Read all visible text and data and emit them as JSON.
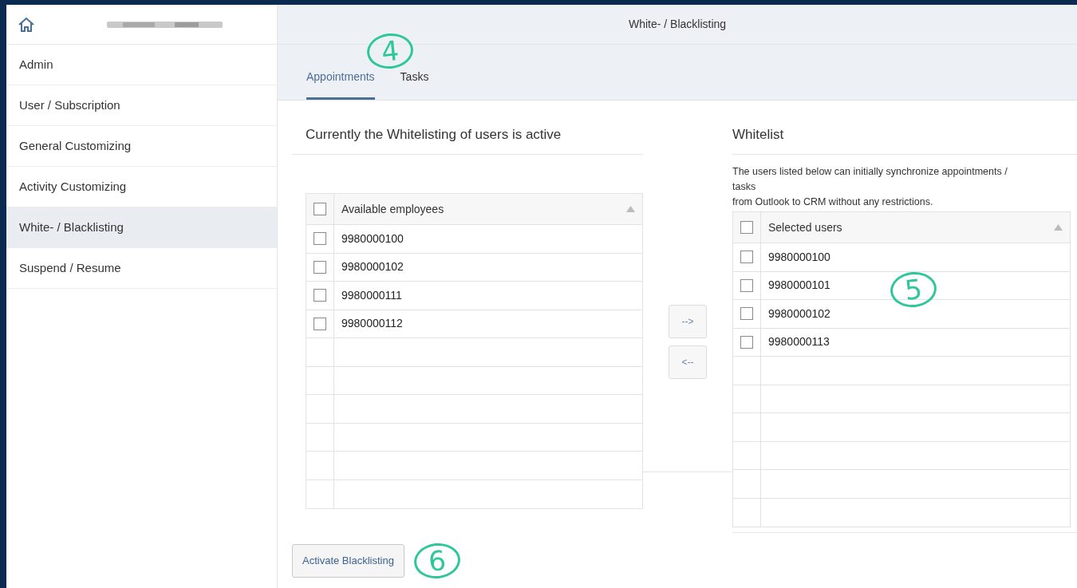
{
  "sidebar": {
    "items": [
      {
        "label": "Admin",
        "selected": false
      },
      {
        "label": "User / Subscription",
        "selected": false
      },
      {
        "label": "General Customizing",
        "selected": false
      },
      {
        "label": "Activity Customizing",
        "selected": false
      },
      {
        "label": "White- / Blacklisting",
        "selected": true
      },
      {
        "label": "Suspend / Resume",
        "selected": false
      }
    ]
  },
  "header": {
    "title": "White- / Blacklisting"
  },
  "tabs": [
    {
      "label": "Appointments",
      "selected": true
    },
    {
      "label": "Tasks",
      "selected": false
    }
  ],
  "tabs_callout": "4",
  "status_text": "Currently the Whitelisting of users is active",
  "available_table": {
    "header": {
      "label": "Available employees",
      "checked": false
    },
    "rows": [
      {
        "value": "9980000100",
        "checked": false
      },
      {
        "value": "9980000102",
        "checked": false
      },
      {
        "value": "9980000111",
        "checked": false
      },
      {
        "value": "9980000112",
        "checked": false
      }
    ]
  },
  "move_buttons": [
    "-->",
    "<--"
  ],
  "whitelist": {
    "title": "Whitelist",
    "description_lines": [
      "The users listed below can initially synchronize appointments /",
      "tasks",
      "from Outlook to CRM without any restrictions."
    ],
    "callout": "5",
    "table": {
      "header": {
        "label": "Selected users",
        "checked": false
      },
      "rows": [
        {
          "value": "9980000100",
          "checked": false
        },
        {
          "value": "9980000101",
          "checked": false
        },
        {
          "value": "9980000102",
          "checked": false
        },
        {
          "value": "9980000113",
          "checked": false
        }
      ]
    }
  },
  "footer": {
    "button": "Activate Blacklisting",
    "callout": "6"
  }
}
